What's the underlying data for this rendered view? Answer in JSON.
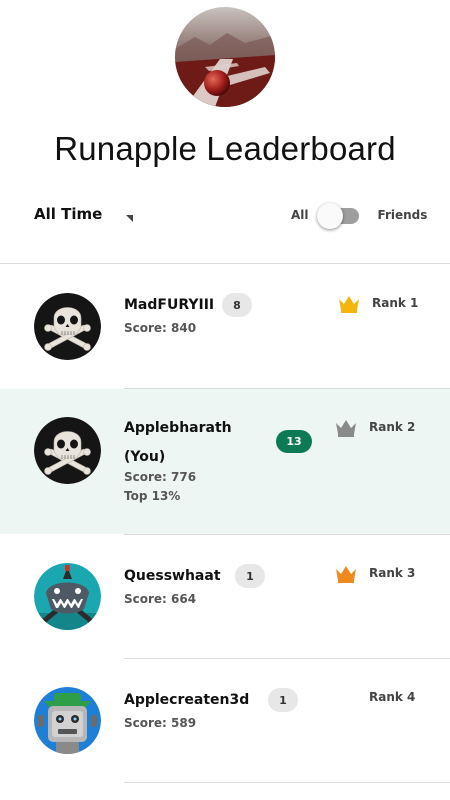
{
  "header": {
    "title": "Runapple Leaderboard"
  },
  "filter": {
    "label": "All Time"
  },
  "toggle": {
    "left_label": "All",
    "right_label": "Friends"
  },
  "entries": [
    {
      "name": "MadFURYIII",
      "badge": "8",
      "score": "Score: 840",
      "rank": "Rank 1",
      "crown_color": "#f5b50e",
      "avatar": "skull"
    },
    {
      "name": "Applebharath",
      "you": "(You)",
      "badge": "13",
      "score": "Score: 776",
      "top": "Top 13%",
      "rank": "Rank 2",
      "crown_color": "#8a8a8a",
      "avatar": "skull"
    },
    {
      "name": "Quesswhaat",
      "badge": "1",
      "score": "Score: 664",
      "rank": "Rank 3",
      "crown_color": "#ef8a1f",
      "avatar": "shark"
    },
    {
      "name": "Applecreaten3d",
      "badge": "1",
      "score": "Score: 589",
      "rank": "Rank 4",
      "avatar": "robot"
    }
  ],
  "colors": {
    "accent": "#0d7a55",
    "highlight_row": "#eef6f3"
  }
}
